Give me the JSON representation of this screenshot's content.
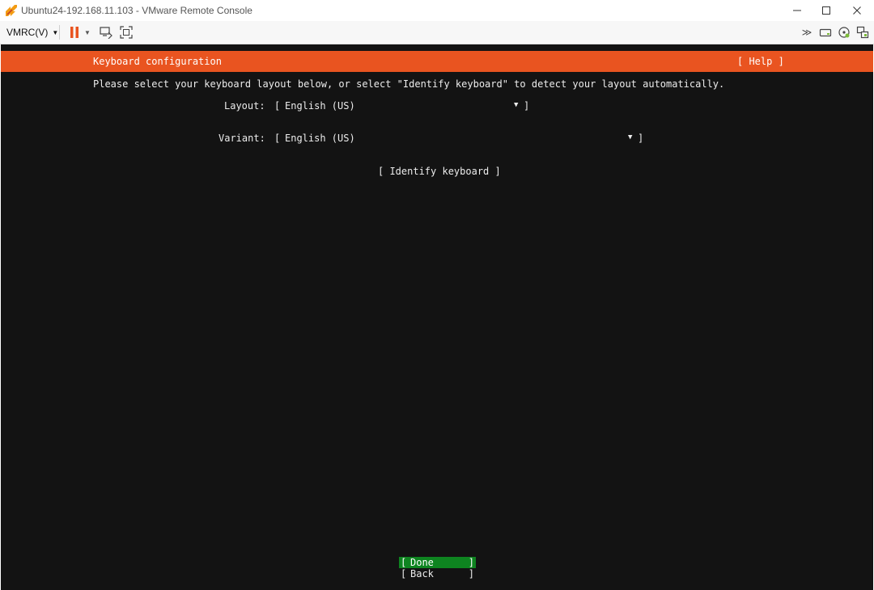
{
  "window": {
    "title": "Ubuntu24-192.168.11.103 - VMware Remote Console",
    "minimize_icon": "minimize-icon",
    "maximize_icon": "maximize-icon",
    "close_icon": "close-icon"
  },
  "toolbar": {
    "menu_label": "VMRC(V)",
    "icons": [
      "pause-icon",
      "send-ctrl-alt-del-icon",
      "fullscreen-icon",
      "more-icon",
      "removable-devices-icon",
      "cd-dvd-icon",
      "unity-icon"
    ],
    "colors": {
      "pause": "#e95420",
      "accent": "#7dbb3a"
    }
  },
  "installer": {
    "header": {
      "title": "Keyboard configuration",
      "help": "[ Help ]",
      "color": "#e95420"
    },
    "instruction": "Please select your keyboard layout below, or select \"Identify keyboard\" to detect your layout automatically.",
    "layout": {
      "label": "Layout:",
      "value": "English (US)"
    },
    "variant": {
      "label": "Variant:",
      "value": "English (US)"
    },
    "identify_button": "[ Identify keyboard ]",
    "buttons": {
      "done": "Done",
      "back": "Back",
      "done_color": "#0e8420"
    },
    "background_color": "#131313"
  }
}
